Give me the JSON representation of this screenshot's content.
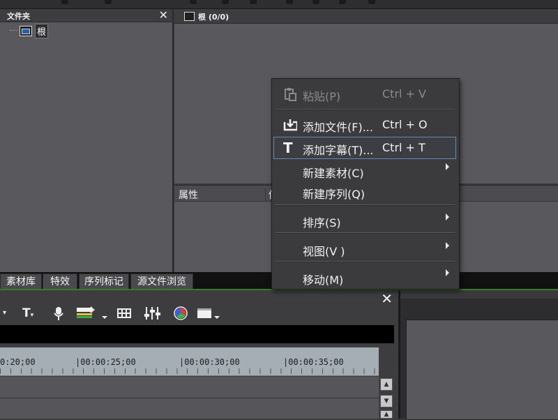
{
  "folder_panel": {
    "title": "文件夹",
    "close": "✕",
    "tree_root": "根"
  },
  "root_panel": {
    "title": "根 (0/0)"
  },
  "properties_panel": {
    "col_property": "属性",
    "col_value": "值"
  },
  "bottom_tabs": [
    "素材库",
    "特效",
    "序列标记",
    "源文件浏览"
  ],
  "context_menu": {
    "items": [
      {
        "label": "粘贴(P)",
        "shortcut": "Ctrl + V",
        "enabled": false,
        "icon": "paste-icon"
      },
      {
        "label": "添加文件(F)...",
        "shortcut": "Ctrl + O",
        "enabled": true,
        "icon": "add-file-icon"
      },
      {
        "label": "添加字幕(T)...",
        "shortcut": "Ctrl + T",
        "enabled": true,
        "icon": "title-icon",
        "highlighted": true
      },
      {
        "label": "新建素材(C)",
        "submenu": true
      },
      {
        "label": "新建序列(Q)"
      },
      {
        "label": "排序(S)",
        "submenu": true
      },
      {
        "label": "视图(V )",
        "submenu": true
      },
      {
        "label": "移动(M)",
        "submenu": true
      }
    ]
  },
  "timeline": {
    "close": "✕",
    "timecodes": [
      "0:20;00",
      "|00:00:25;00",
      "|00:00:30;00",
      "|00:00:35;00"
    ],
    "toolbar_icons": [
      "dropdown-icon",
      "title-tool-icon",
      "microphone-icon",
      "audio-route-icon",
      "grid-icon",
      "mixer-icon",
      "color-wheel-icon",
      "monitor-icon"
    ]
  },
  "colors": {
    "panel": "#59595d",
    "header": "#3d3d40",
    "menu": "#3b3b3e",
    "highlight_border": "#6a86b6",
    "ruler": "#a5adb5",
    "accent_green": "#3a7a2a"
  }
}
